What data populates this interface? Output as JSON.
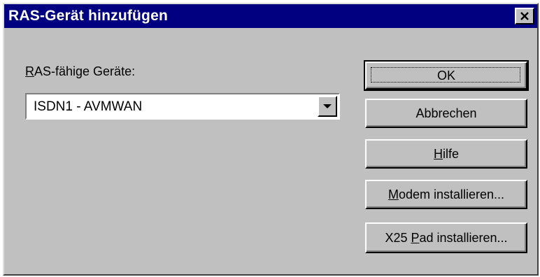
{
  "dialog": {
    "title": "RAS-Gerät hinzufügen",
    "close_icon": "close-icon"
  },
  "device_field": {
    "label_mnemonic": "R",
    "label_rest": "AS-fähige Geräte:",
    "value": "ISDN1 - AVMWAN",
    "dropdown_icon": "chevron-down-icon"
  },
  "buttons": {
    "ok": "OK",
    "cancel": "Abbrechen",
    "help_mnemonic": "H",
    "help_rest": "ilfe",
    "modem_mnemonic": "M",
    "modem_rest": "odem installieren...",
    "x25_prefix": "X25 ",
    "x25_mnemonic": "P",
    "x25_rest": "ad installieren..."
  },
  "colors": {
    "face": "#c0c0c0",
    "titlebar": "#000080",
    "title_text": "#ffffff"
  }
}
